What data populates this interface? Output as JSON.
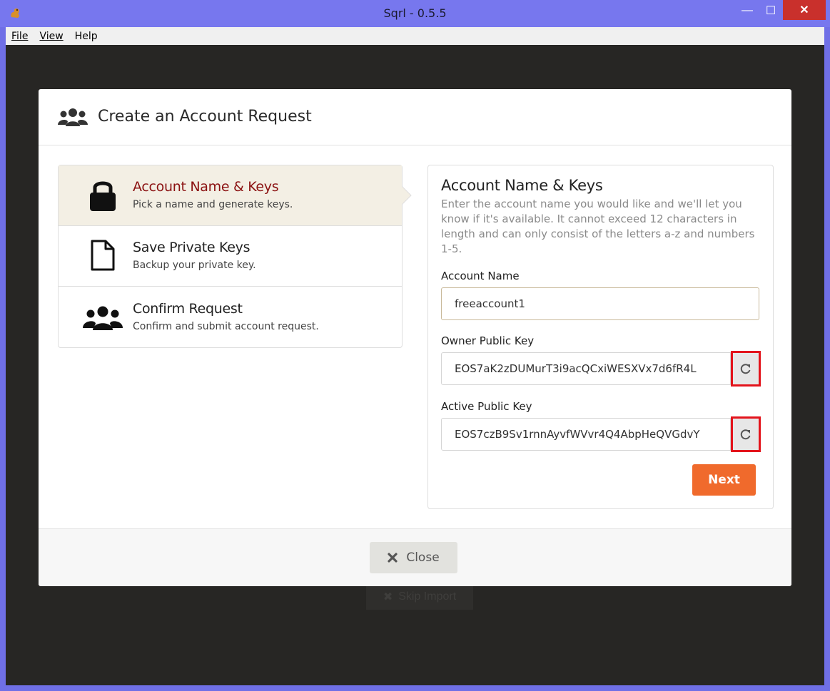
{
  "window": {
    "title": "Sqrl  -  0.5.5",
    "minimize_glyph": "—",
    "maximize_glyph": "☐",
    "close_glyph": "✕"
  },
  "menu": {
    "file": "File",
    "view": "View",
    "help": "Help"
  },
  "background": {
    "skip_import_label": "Skip Import"
  },
  "modal": {
    "title": "Create an Account Request",
    "header_icon": "users-icon",
    "steps": [
      {
        "title": "Account Name & Keys",
        "description": "Pick a name and generate keys.",
        "icon": "lock-icon",
        "active": true
      },
      {
        "title": "Save Private Keys",
        "description": "Backup your private key.",
        "icon": "file-icon",
        "active": false
      },
      {
        "title": "Confirm Request",
        "description": "Confirm and submit account request.",
        "icon": "users-icon",
        "active": false
      }
    ],
    "form": {
      "title": "Account Name & Keys",
      "description": "Enter the account name you would like and we'll let you know if it's available. It cannot exceed 12 characters in length and can only consist of the letters a-z and numbers 1-5.",
      "account_name_label": "Account Name",
      "account_name_value": "freeaccount1",
      "owner_key_label": "Owner Public Key",
      "owner_key_value": "EOS7aK2zDUMurT3i9acQCxiWESXVx7d6fR4L",
      "active_key_label": "Active Public Key",
      "active_key_value": "EOS7czB9Sv1rnnAyvfWVvr4Q4AbpHeQVGdvY",
      "next_label": "Next"
    },
    "close_label": "Close"
  },
  "colors": {
    "accent_orange": "#f06a2c",
    "active_step_title": "#8b1212",
    "highlight_red": "#e3141c",
    "titlebar": "#7777ee"
  }
}
